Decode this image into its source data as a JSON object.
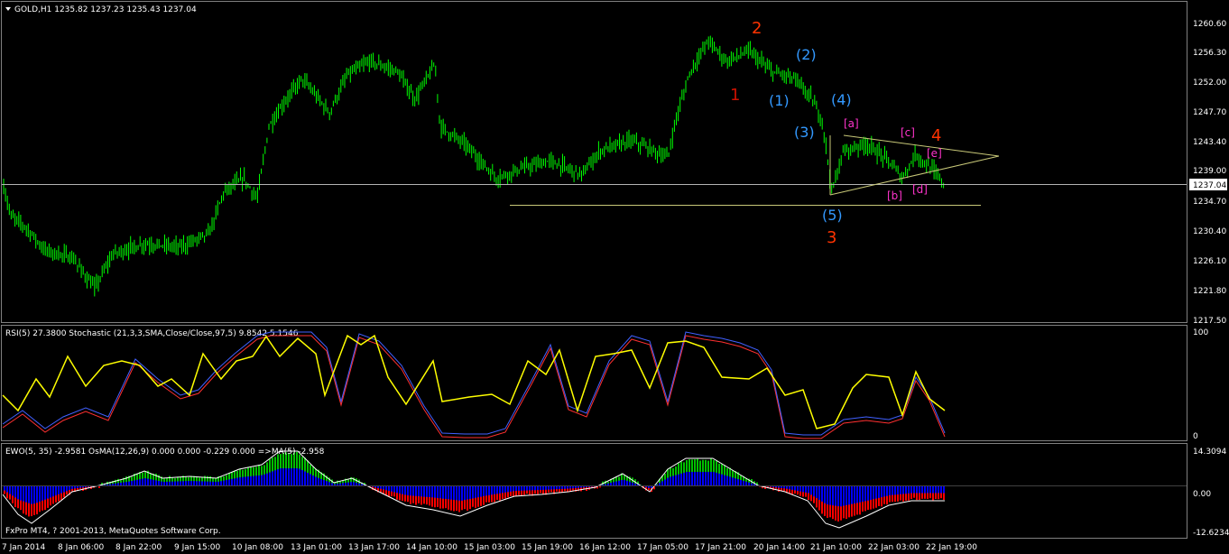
{
  "main": {
    "header": "GOLD,H1  1235.82 1237.23 1235.43 1237.04",
    "price_labels": [
      "1260.60",
      "1256.30",
      "1252.00",
      "1247.70",
      "1243.40",
      "1239.00",
      "1234.70",
      "1230.40",
      "1226.10",
      "1221.80",
      "1217.50"
    ],
    "current_price": "1237.04",
    "wave_labels": [
      {
        "text": "2",
        "kind": "major"
      },
      {
        "text": "1",
        "kind": "major-dark"
      },
      {
        "text": "(2)",
        "kind": "minor"
      },
      {
        "text": "(1)",
        "kind": "minor"
      },
      {
        "text": "(4)",
        "kind": "minor"
      },
      {
        "text": "(3)",
        "kind": "minor"
      },
      {
        "text": "[a]",
        "kind": "sub"
      },
      {
        "text": "[c]",
        "kind": "sub"
      },
      {
        "text": "4",
        "kind": "major"
      },
      {
        "text": "[e]",
        "kind": "sub"
      },
      {
        "text": "[b]",
        "kind": "sub"
      },
      {
        "text": "[d]",
        "kind": "sub"
      },
      {
        "text": "(5)",
        "kind": "minor"
      },
      {
        "text": "3",
        "kind": "major"
      }
    ]
  },
  "rsi_panel": {
    "header": "RSI(5) 27.3800  Stochastic (21,3,3,SMA,Close/Close,97,5) 9.8542 5.1546",
    "scale_labels": [
      "100",
      "0"
    ]
  },
  "ewo_panel": {
    "header": "EWO(5, 35) -2.9581  OsMA(12,26,9) 0.000 0.000 -0.229 0.000  =>MA(5) -2.958",
    "scale_labels": [
      "14.3094",
      "0.00",
      "-12.6234"
    ],
    "copyright": "FxPro MT4, ? 2001-2013, MetaQuotes Software Corp."
  },
  "time_labels": [
    "7 Jan 2014",
    "8 Jan 06:00",
    "8 Jan 22:00",
    "9 Jan 15:00",
    "10 Jan 08:00",
    "13 Jan 01:00",
    "13 Jan 17:00",
    "14 Jan 10:00",
    "15 Jan 03:00",
    "15 Jan 19:00",
    "16 Jan 12:00",
    "17 Jan 05:00",
    "17 Jan 21:00",
    "20 Jan 14:00",
    "21 Jan 10:00",
    "22 Jan 03:00",
    "22 Jan 19:00"
  ],
  "colors": {
    "bull_candle": "#00ff00",
    "rsi_line": "#ffff00",
    "stoch_main": "#4060ff",
    "stoch_signal": "#ff3030",
    "ewo_positive": "#00c000",
    "ewo_negative": "#ff0000",
    "osma_bar": "#0000ff",
    "major_wave": "#ff3300",
    "minor_wave": "#3399ff",
    "sub_wave": "#ff33cc"
  },
  "chart_data": {
    "type": "candlestick",
    "symbol": "GOLD",
    "timeframe": "H1",
    "ohlc_last": {
      "open": 1235.82,
      "high": 1237.23,
      "low": 1235.43,
      "close": 1237.04
    },
    "ylim": [
      1217.5,
      1262.0
    ],
    "close_path": [
      [
        0,
        1239.0
      ],
      [
        12,
        1232.5
      ],
      [
        28,
        1231.0
      ],
      [
        50,
        1227.5
      ],
      [
        80,
        1226.5
      ],
      [
        105,
        1222.0
      ],
      [
        125,
        1227.0
      ],
      [
        160,
        1228.5
      ],
      [
        200,
        1228.0
      ],
      [
        232,
        1230.0
      ],
      [
        248,
        1236.0
      ],
      [
        270,
        1238.0
      ],
      [
        285,
        1235.0
      ],
      [
        298,
        1245.5
      ],
      [
        315,
        1249.0
      ],
      [
        335,
        1252.5
      ],
      [
        365,
        1247.5
      ],
      [
        385,
        1253.0
      ],
      [
        410,
        1255.0
      ],
      [
        440,
        1253.5
      ],
      [
        460,
        1249.5
      ],
      [
        482,
        1254.5
      ],
      [
        488,
        1245.5
      ],
      [
        515,
        1243.0
      ],
      [
        550,
        1238.0
      ],
      [
        580,
        1239.5
      ],
      [
        610,
        1240.5
      ],
      [
        645,
        1238.5
      ],
      [
        665,
        1242.0
      ],
      [
        700,
        1243.5
      ],
      [
        740,
        1241.0
      ],
      [
        750,
        1247.0
      ],
      [
        765,
        1253.5
      ],
      [
        785,
        1258.0
      ],
      [
        805,
        1255.0
      ],
      [
        830,
        1256.5
      ],
      [
        855,
        1253.5
      ],
      [
        880,
        1252.5
      ],
      [
        900,
        1249.5
      ],
      [
        912,
        1246.0
      ],
      [
        922,
        1236.0
      ],
      [
        935,
        1242.0
      ],
      [
        960,
        1243.0
      ],
      [
        985,
        1240.5
      ],
      [
        1000,
        1238.0
      ],
      [
        1015,
        1241.5
      ],
      [
        1035,
        1239.0
      ],
      [
        1047,
        1237.0
      ]
    ],
    "rsi_yellow_path": [
      [
        3,
        438
      ],
      [
        20,
        455
      ],
      [
        40,
        420
      ],
      [
        55,
        440
      ],
      [
        75,
        395
      ],
      [
        95,
        428
      ],
      [
        115,
        405
      ],
      [
        135,
        400
      ],
      [
        155,
        405
      ],
      [
        175,
        428
      ],
      [
        190,
        420
      ],
      [
        210,
        438
      ],
      [
        225,
        392
      ],
      [
        245,
        420
      ],
      [
        262,
        400
      ],
      [
        280,
        395
      ],
      [
        295,
        373
      ],
      [
        310,
        395
      ],
      [
        330,
        375
      ],
      [
        350,
        392
      ],
      [
        360,
        438
      ],
      [
        385,
        372
      ],
      [
        400,
        382
      ],
      [
        415,
        372
      ],
      [
        430,
        418
      ],
      [
        450,
        448
      ],
      [
        480,
        400
      ],
      [
        490,
        445
      ],
      [
        520,
        440
      ],
      [
        545,
        437
      ],
      [
        565,
        448
      ],
      [
        585,
        400
      ],
      [
        605,
        415
      ],
      [
        620,
        388
      ],
      [
        640,
        455
      ],
      [
        660,
        395
      ],
      [
        680,
        392
      ],
      [
        700,
        388
      ],
      [
        720,
        430
      ],
      [
        740,
        380
      ],
      [
        760,
        378
      ],
      [
        780,
        385
      ],
      [
        800,
        418
      ],
      [
        830,
        420
      ],
      [
        850,
        408
      ],
      [
        870,
        438
      ],
      [
        890,
        432
      ],
      [
        905,
        475
      ],
      [
        925,
        470
      ],
      [
        945,
        430
      ],
      [
        960,
        415
      ],
      [
        985,
        418
      ],
      [
        1000,
        460
      ],
      [
        1015,
        412
      ],
      [
        1030,
        442
      ],
      [
        1047,
        455
      ]
    ],
    "stoch_path": [
      [
        3,
        470
      ],
      [
        25,
        455
      ],
      [
        50,
        475
      ],
      [
        70,
        462
      ],
      [
        95,
        452
      ],
      [
        120,
        462
      ],
      [
        150,
        398
      ],
      [
        175,
        420
      ],
      [
        200,
        438
      ],
      [
        220,
        432
      ],
      [
        240,
        410
      ],
      [
        260,
        392
      ],
      [
        285,
        372
      ],
      [
        300,
        368
      ],
      [
        320,
        368
      ],
      [
        345,
        368
      ],
      [
        362,
        385
      ],
      [
        378,
        445
      ],
      [
        398,
        370
      ],
      [
        420,
        378
      ],
      [
        445,
        405
      ],
      [
        470,
        450
      ],
      [
        490,
        480
      ],
      [
        515,
        481
      ],
      [
        540,
        481
      ],
      [
        560,
        475
      ],
      [
        590,
        420
      ],
      [
        610,
        382
      ],
      [
        630,
        450
      ],
      [
        650,
        458
      ],
      [
        675,
        400
      ],
      [
        700,
        372
      ],
      [
        720,
        378
      ],
      [
        740,
        445
      ],
      [
        760,
        368
      ],
      [
        780,
        372
      ],
      [
        800,
        375
      ],
      [
        820,
        380
      ],
      [
        840,
        388
      ],
      [
        855,
        410
      ],
      [
        870,
        480
      ],
      [
        890,
        482
      ],
      [
        910,
        482
      ],
      [
        935,
        465
      ],
      [
        960,
        462
      ],
      [
        985,
        465
      ],
      [
        1000,
        460
      ],
      [
        1015,
        418
      ],
      [
        1030,
        440
      ],
      [
        1047,
        480
      ]
    ],
    "ewo_path": [
      [
        3,
        548
      ],
      [
        20,
        570
      ],
      [
        35,
        580
      ],
      [
        55,
        565
      ],
      [
        80,
        545
      ],
      [
        110,
        538
      ],
      [
        140,
        530
      ],
      [
        160,
        522
      ],
      [
        180,
        530
      ],
      [
        210,
        528
      ],
      [
        240,
        530
      ],
      [
        265,
        520
      ],
      [
        290,
        515
      ],
      [
        310,
        500
      ],
      [
        330,
        500
      ],
      [
        350,
        520
      ],
      [
        370,
        535
      ],
      [
        390,
        530
      ],
      [
        420,
        545
      ],
      [
        450,
        560
      ],
      [
        480,
        565
      ],
      [
        510,
        572
      ],
      [
        540,
        560
      ],
      [
        570,
        550
      ],
      [
        600,
        548
      ],
      [
        630,
        545
      ],
      [
        660,
        540
      ],
      [
        690,
        525
      ],
      [
        720,
        545
      ],
      [
        740,
        520
      ],
      [
        760,
        508
      ],
      [
        790,
        508
      ],
      [
        810,
        520
      ],
      [
        840,
        538
      ],
      [
        870,
        545
      ],
      [
        895,
        555
      ],
      [
        915,
        580
      ],
      [
        930,
        585
      ],
      [
        960,
        572
      ],
      [
        985,
        560
      ],
      [
        1010,
        555
      ],
      [
        1047,
        555
      ]
    ]
  }
}
